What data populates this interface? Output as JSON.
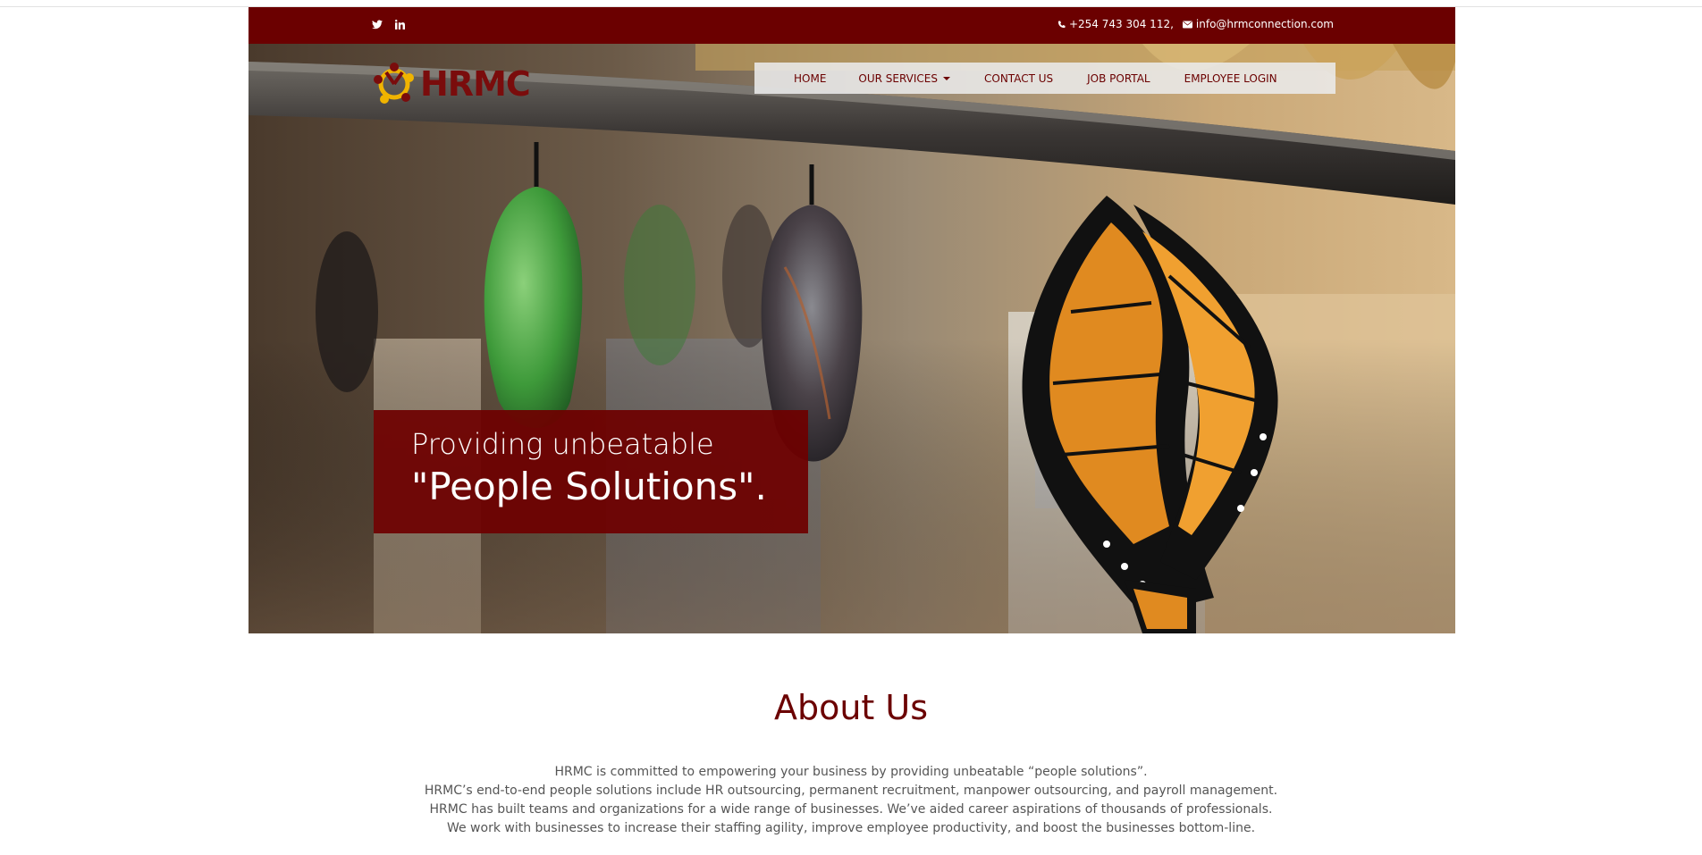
{
  "topbar": {
    "social": [
      {
        "icon": "twitter-icon"
      },
      {
        "icon": "linkedin-icon"
      }
    ],
    "phone": "+254 743 304 112,",
    "email": "info@hrmconnection.com"
  },
  "brand": {
    "logo_text": "HRMC",
    "colors": {
      "maroon": "#6b0000",
      "gold": "#f0b400"
    }
  },
  "nav": {
    "home": "HOME",
    "services": "OUR SERVICES",
    "contact": "CONTACT US",
    "jobs": "JOB PORTAL",
    "login": "EMPLOYEE LOGIN"
  },
  "hero": {
    "line1": "Providing unbeatable",
    "line2": "\"People Solutions\"."
  },
  "about": {
    "title": "About Us",
    "paragraphs": [
      "HRMC is committed to empowering your business by providing unbeatable “people solutions”.",
      "HRMC’s end-to-end people solutions include HR outsourcing, permanent recruitment, manpower outsourcing, and payroll management.",
      "HRMC has built teams and organizations for a wide range of businesses. We’ve aided career aspirations of thousands of professionals.",
      "We work with businesses to increase their staffing agility, improve employee productivity, and boost the businesses bottom-line."
    ]
  }
}
